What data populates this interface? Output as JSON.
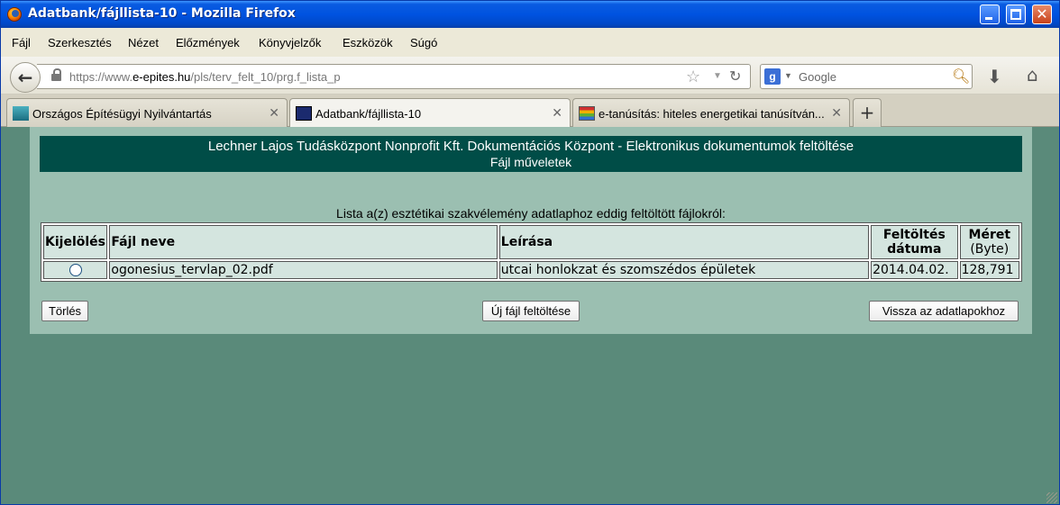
{
  "window": {
    "title": "Adatbank/fájllista-10 - Mozilla Firefox"
  },
  "menu": [
    "Fájl",
    "Szerkesztés",
    "Nézet",
    "Előzmények",
    "Könyvjelzők",
    "Eszközök",
    "Súgó"
  ],
  "nav": {
    "url_prefix": "https://www.",
    "url_domain": "e-epites.hu",
    "url_path": "/pls/terv_felt_10/prg.f_lista_p",
    "search_engine": "Google",
    "search_placeholder": "Google"
  },
  "tabs": [
    {
      "label": "Országos Építésügyi Nyilvántartás",
      "icon": "oeny-favicon",
      "active": false
    },
    {
      "label": "Adatbank/fájllista-10",
      "icon": "adatbank-favicon",
      "active": true
    },
    {
      "label": "e-tanúsítás: hiteles energetikai tanúsítván...",
      "icon": "energy-favicon",
      "active": false
    }
  ],
  "page": {
    "header_title": "Lechner Lajos Tudásközpont Nonprofit Kft. Dokumentációs Központ - Elektronikus dokumentumok feltöltése",
    "header_subtitle": "Fájl műveletek",
    "caption": "Lista a(z) esztétikai szakvélemény adatlaphoz eddig feltöltött fájlokról:",
    "columns": {
      "select": "Kijelölés",
      "filename": "Fájl neve",
      "description": "Leírása",
      "upload_date_l1": "Feltöltés",
      "upload_date_l2": "dátuma",
      "size_l1": "Méret",
      "size_l2": "(Byte)"
    },
    "rows": [
      {
        "filename": "ogonesius_tervlap_02.pdf",
        "description": "utcai honlokzat és szomszédos épületek",
        "date": "2014.04.02.",
        "size": "128,791"
      }
    ],
    "buttons": {
      "delete": "Törlés",
      "upload": "Új fájl feltöltése",
      "back": "Vissza az adatlapokhoz"
    }
  },
  "colors": {
    "titlebar": "#0053e0",
    "header_band": "#004d47",
    "panel": "#9bbfb1",
    "page_bg": "#5a8a7a"
  }
}
